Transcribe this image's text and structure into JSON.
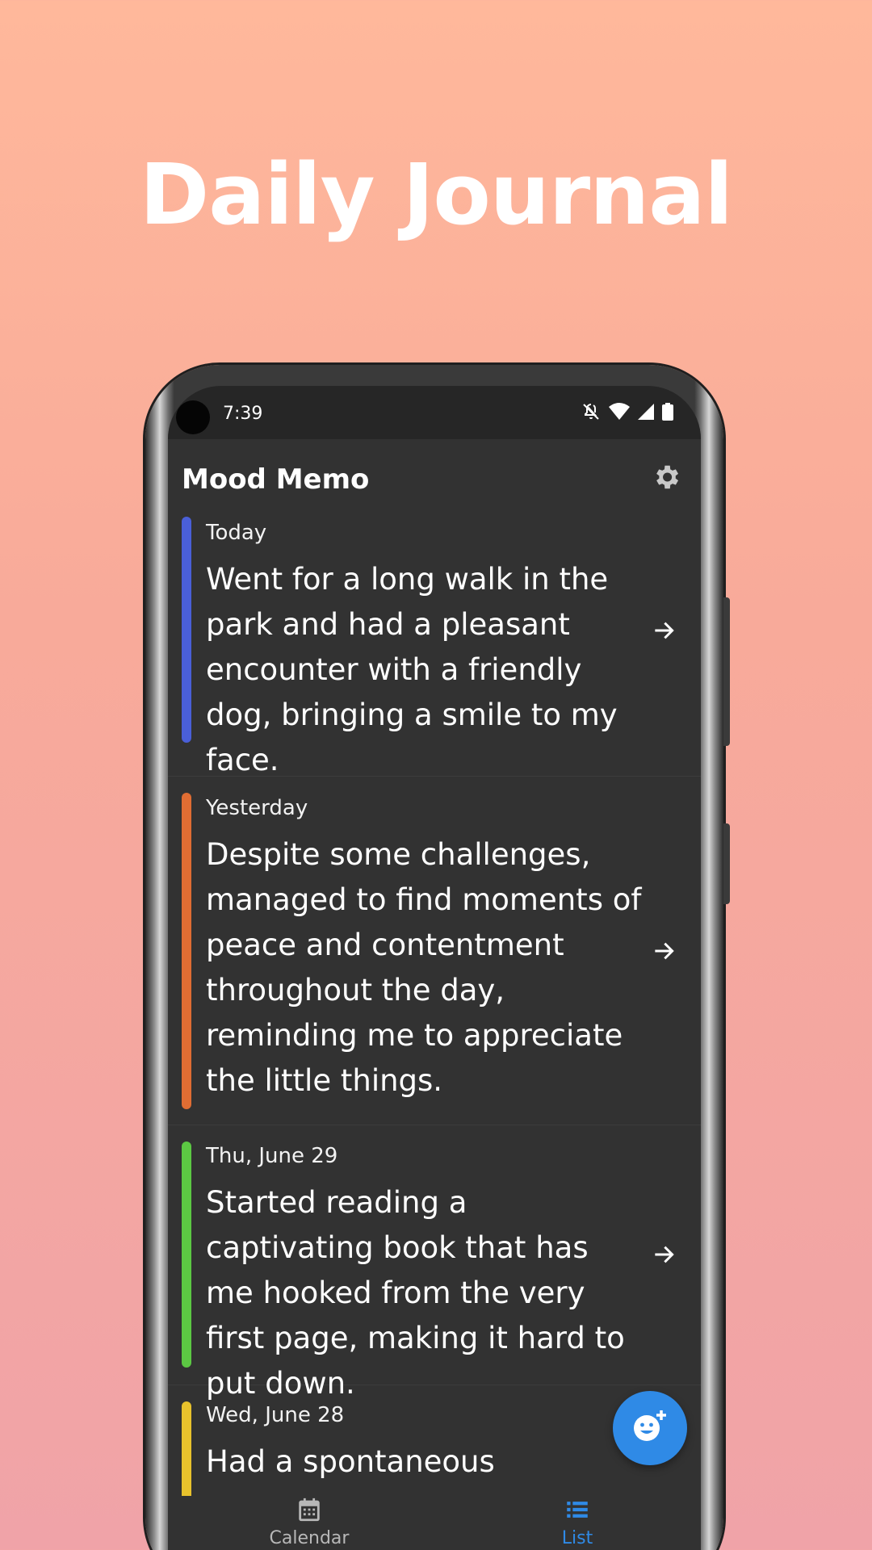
{
  "promo": {
    "headline": "Daily Journal"
  },
  "statusbar": {
    "time": "7:39"
  },
  "app": {
    "title": "Mood Memo"
  },
  "entries": [
    {
      "date": "Today",
      "text": "Went for a long walk in the park and had a pleasant encounter with a friendly dog, bringing a smile to my face.",
      "mood_color": "#4a5fd8"
    },
    {
      "date": "Yesterday",
      "text": "Despite some challenges, managed to find moments of peace and contentment throughout the day, reminding me to appreciate the little things.",
      "mood_color": "#e06d33"
    },
    {
      "date": "Thu, June 29",
      "text": "Started reading a captivating book that has me hooked from the very first page, making it hard to put down.",
      "mood_color": "#5cc843"
    },
    {
      "date": "Wed, June 28",
      "text": "Had a spontaneous",
      "mood_color": "#e8c22c"
    }
  ],
  "nav": {
    "calendar_label": "Calendar",
    "list_label": "List",
    "active_color": "#2f8ae6",
    "inactive_color": "#b8b8b8"
  },
  "icons": {
    "settings": "gear-icon",
    "open_entry": "arrow-right-icon",
    "add_mood": "add-mood-face-icon",
    "calendar": "calendar-icon",
    "list": "list-icon"
  }
}
